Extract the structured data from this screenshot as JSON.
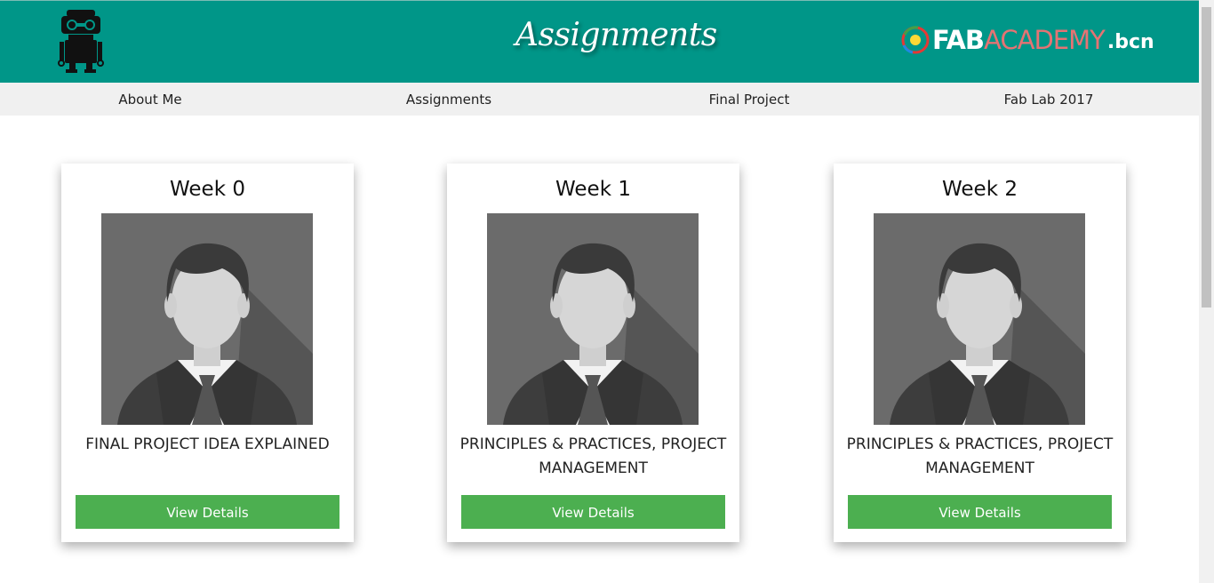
{
  "header": {
    "title": "Assignments",
    "logo_left_icon": "robot-icon",
    "brand": {
      "part1": "FAB",
      "part2": "ACADEMY",
      "part3": ".bcn"
    }
  },
  "nav": {
    "items": [
      {
        "label": "About Me"
      },
      {
        "label": "Assignments"
      },
      {
        "label": "Final Project"
      },
      {
        "label": "Fab Lab 2017"
      }
    ]
  },
  "cards": [
    {
      "title": "Week 0",
      "desc": "FINAL PROJECT IDEA EXPLAINED",
      "button": "View Details",
      "image_icon": "avatar-placeholder-icon"
    },
    {
      "title": "Week 1",
      "desc": "PRINCIPLES & PRACTICES, PROJECT MANAGEMENT",
      "button": "View Details",
      "image_icon": "avatar-placeholder-icon"
    },
    {
      "title": "Week 2",
      "desc": "PRINCIPLES & PRACTICES, PROJECT MANAGEMENT",
      "button": "View Details",
      "image_icon": "avatar-placeholder-icon"
    }
  ],
  "colors": {
    "header_bg": "#009688",
    "nav_bg": "#f0f0f0",
    "button_bg": "#4caf50",
    "brand_accent": "#e57373"
  }
}
